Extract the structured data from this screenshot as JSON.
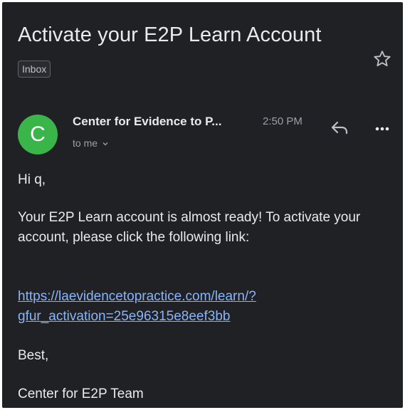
{
  "email": {
    "subject": "Activate your E2P Learn Account",
    "label": "Inbox",
    "sender": {
      "avatar_initial": "C",
      "avatar_color": "#3ab54a",
      "name": "Center for Evidence to P...",
      "time": "2:50 PM",
      "recipient": "to me"
    },
    "body": {
      "greeting": "Hi q,",
      "intro": "Your E2P Learn account is almost ready! To activate your account, please click the following link:",
      "link_line1": "https://laevidencetopractice.com/learn/?",
      "link_line2": "gfur_activation=25e96315e8eef3bb",
      "signoff": "Best,",
      "signature": "Center for E2P Team"
    }
  },
  "icons": {
    "star": "star-icon",
    "reply": "reply-icon",
    "more": "more-vertical-icon",
    "chevron": "chevron-down-icon"
  },
  "colors": {
    "background": "#202124",
    "link": "#8ab4f8",
    "text": "#e8eaed",
    "muted": "#9aa0a6"
  }
}
